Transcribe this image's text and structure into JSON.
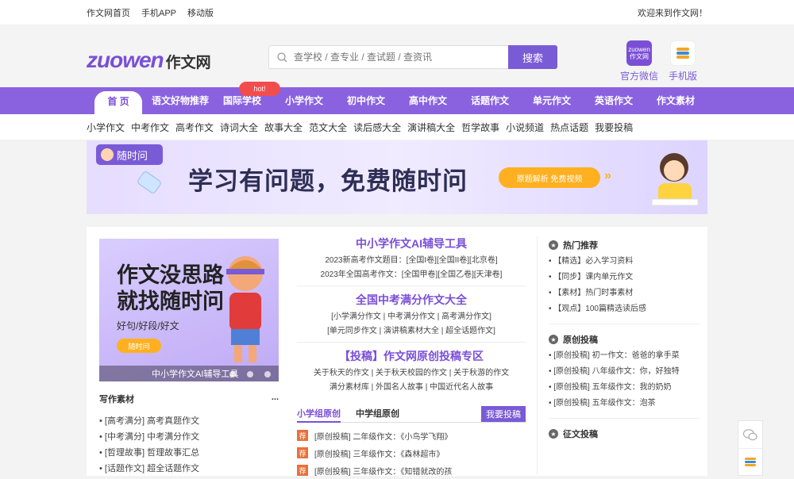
{
  "topbar": {
    "links": [
      "作文网首页",
      "手机APP",
      "移动版"
    ],
    "welcome": "欢迎来到作文网！"
  },
  "logo": {
    "en": "zuowen",
    "cn": "作文网"
  },
  "search": {
    "placeholder": "查学校 / 查专业 / 查试题 / 查资讯",
    "button": "搜索"
  },
  "header_icons": [
    {
      "label": "官方微信",
      "icon": "zuowen作文网",
      "color": "#7a4fd6"
    },
    {
      "label": "手机版",
      "icon": "layers-icon",
      "color": "#f5a623"
    }
  ],
  "nav": {
    "items": [
      "首 页",
      "语文好物推荐",
      "国际学校",
      "小学作文",
      "初中作文",
      "高中作文",
      "话题作文",
      "单元作文",
      "英语作文",
      "作文素材"
    ],
    "hot": "hot!"
  },
  "subnav": [
    "小学作文",
    "中考作文",
    "高考作文",
    "诗词大全",
    "故事大全",
    "范文大全",
    "读后感大全",
    "演讲稿大全",
    "哲学故事",
    "小说频道",
    "热点话题",
    "我要投稿"
  ],
  "banner": {
    "tag": "随时问",
    "title": "学习有问题，免费随时问",
    "pill": "原题解析 免费视频"
  },
  "promo": {
    "line1": "作文没思路",
    "line2": "就找随时问",
    "line3": "好句/好段/好文",
    "button": "随时问",
    "caption": "中小学作文AI辅导工具"
  },
  "left_section": {
    "title": "写作素材",
    "more": "...",
    "items": [
      "[高考满分] 高考真题作文",
      "[中考满分] 中考满分作文",
      "[哲理故事] 哲理故事汇总",
      "[话题作文] 超全话题作文"
    ]
  },
  "mid": {
    "blocks": [
      {
        "title": "中小学作文AI辅导工具",
        "lines": [
          "2023新高考作文题目：[全国I卷][全国II卷][北京卷]",
          "2023年全国高考作文：[全国甲卷][全国乙卷][天津卷]"
        ]
      },
      {
        "title": "全国中考满分作文大全",
        "lines": [
          "[小学满分作文 | 中考满分作文 | 高考满分作文]",
          "[单元同步作文 | 演讲稿素材大全 | 超全话题作文]"
        ]
      },
      {
        "title": "【投稿】作文网原创投稿专区",
        "lines": [
          "关于秋天的作文 | 关于秋天校园的作文 | 关于秋游的作文",
          "满分素材库 | 外国名人故事 | 中国近代名人故事"
        ]
      }
    ],
    "tabs": [
      "小学组原创",
      "中学组原创"
    ],
    "submit": "我要投稿",
    "badge": "荐",
    "list": [
      "[原创投稿] 二年级作文：《小鸟学飞翔》",
      "[原创投稿] 三年级作文：《森林超市》",
      "[原创投稿] 三年级作文：《知错就改的孩"
    ]
  },
  "right": {
    "sections": [
      {
        "title": "热门推荐",
        "items": [
          "【精选】必入学习资料",
          "【同步】课内单元作文",
          "【素材】热门时事素材",
          "【观点】100篇精选读后感"
        ]
      },
      {
        "title": "原创投稿",
        "items": [
          "[原创投稿] 初一作文：爸爸的拿手菜",
          "[原创投稿] 八年级作文：你，好独特",
          "[原创投稿] 五年级作文：我的奶奶",
          "[原创投稿] 五年级作文：泡茶"
        ]
      },
      {
        "title": "征文投稿",
        "items": []
      }
    ]
  }
}
